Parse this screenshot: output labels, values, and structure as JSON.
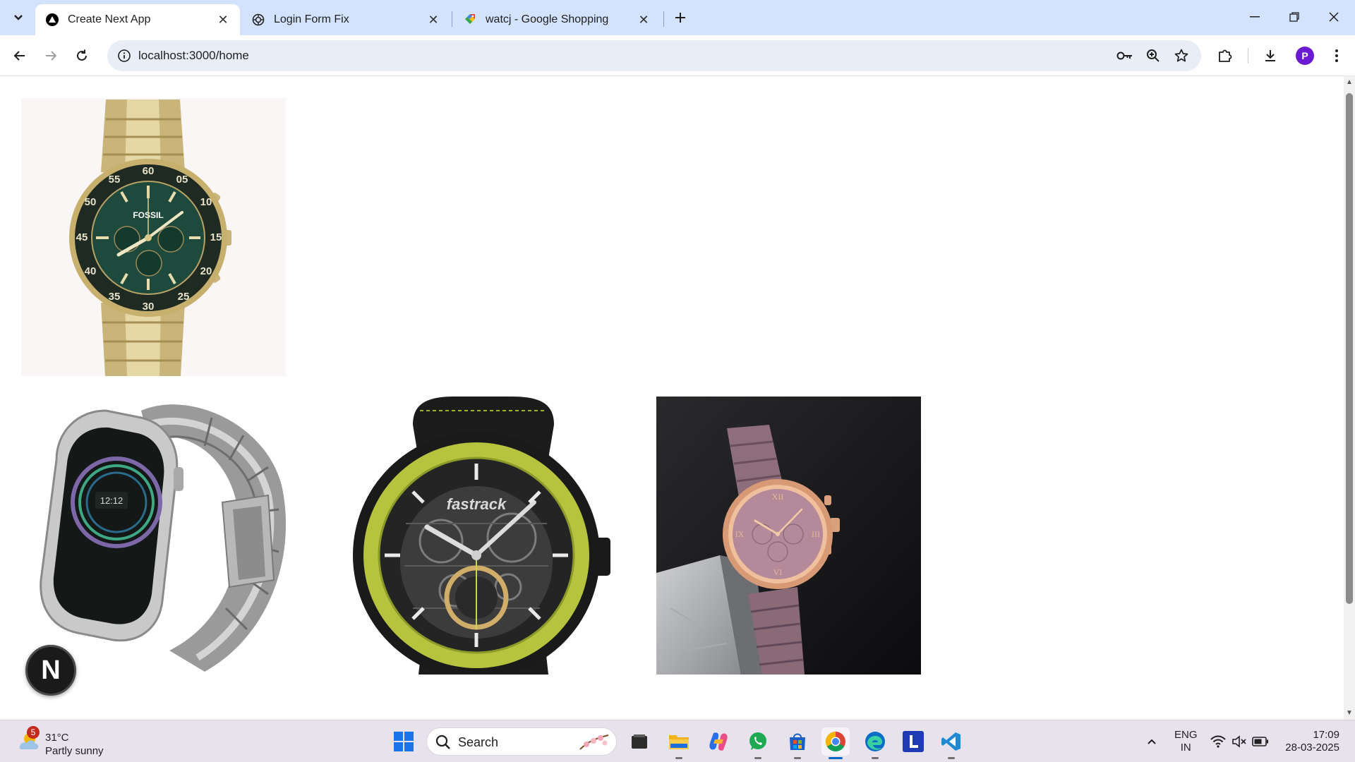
{
  "browser": {
    "tabs": [
      {
        "title": "Create Next App",
        "favicon": "nextjs-triangle-icon",
        "active": true
      },
      {
        "title": "Login Form Fix",
        "favicon": "chatgpt-icon",
        "active": false
      },
      {
        "title": "watcj - Google Shopping",
        "favicon": "google-shopping-icon",
        "active": false
      }
    ],
    "url": "localhost:3000/home",
    "profile_initial": "P"
  },
  "page": {
    "products": [
      {
        "name": "Fossil chronograph watch",
        "brand_text": "FOSSIL",
        "image": "gold-green-chronograph"
      },
      {
        "name": "Steel smartwatch",
        "image": "silver-smartwatch"
      },
      {
        "name": "Fastrack automatic watch",
        "brand_text": "fastrack",
        "image": "green-bezel-skeleton"
      },
      {
        "name": "Rose gold ladies watch",
        "image": "mauve-ladies-watch"
      }
    ],
    "dev_badge": "N"
  },
  "taskbar": {
    "weather": {
      "temp": "31°C",
      "condition": "Partly sunny",
      "badge": "5"
    },
    "search_label": "Search",
    "lang_top": "ENG",
    "lang_bottom": "IN",
    "time": "17:09",
    "date": "28-03-2025"
  },
  "colors": {
    "tabstrip": "#d3e3fd",
    "omnibox": "#e9eef6",
    "taskbar": "#e7e2ec",
    "accent": "#0067c0"
  }
}
